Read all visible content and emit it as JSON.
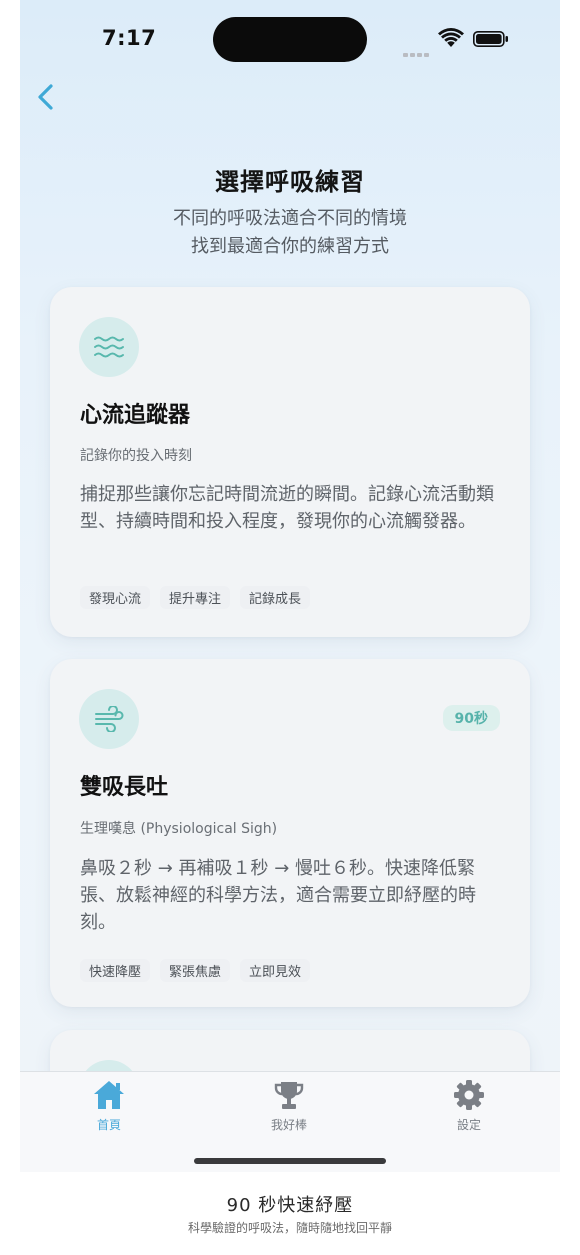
{
  "status_bar": {
    "time": "7:17"
  },
  "header": {
    "title": "選擇呼吸練習",
    "subtitle_line1": "不同的呼吸法適合不同的情境",
    "subtitle_line2": "找到最適合你的練習方式"
  },
  "cards": [
    {
      "icon": "waves-icon",
      "title": "心流追蹤器",
      "subtitle": "記錄你的投入時刻",
      "description": "捕捉那些讓你忘記時間流逝的瞬間。記錄心流活動類型、持續時間和投入程度，發現你的心流觸發器。",
      "tags": [
        "發現心流",
        "提升專注",
        "記錄成長"
      ]
    },
    {
      "icon": "wind-icon",
      "badge": "90秒",
      "title": "雙吸長吐",
      "subtitle": "生理嘆息 (Physiological Sigh)",
      "description": "鼻吸２秒 → 再補吸１秒 → 慢吐６秒。快速降低緊張、放鬆神經的科學方法，適合需要立即紓壓的時刻。",
      "tags": [
        "快速降壓",
        "緊張焦慮",
        "立即見效"
      ]
    }
  ],
  "tab_bar": {
    "items": [
      {
        "label": "首頁",
        "icon": "home-icon",
        "active": true
      },
      {
        "label": "我好棒",
        "icon": "trophy-icon",
        "active": false
      },
      {
        "label": "設定",
        "icon": "gear-icon",
        "active": false
      }
    ]
  },
  "caption": {
    "title": "90 秒快速紓壓",
    "subtitle": "科學驗證的呼吸法，隨時隨地找回平靜"
  },
  "colors": {
    "accent": "#4aa9d9",
    "teal": "#57b3ab",
    "icon_bg": "#d6ecec"
  }
}
